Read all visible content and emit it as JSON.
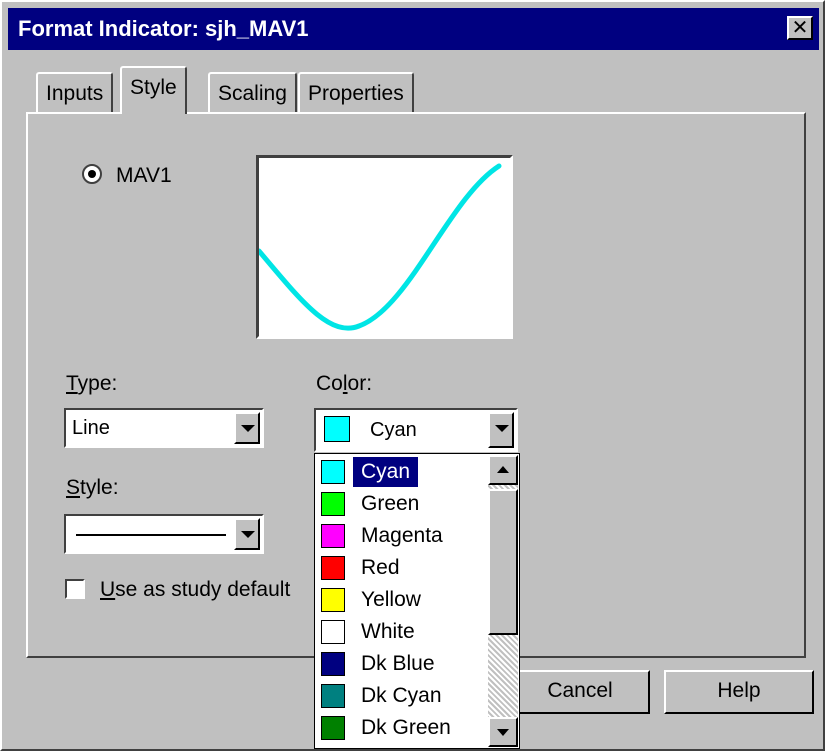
{
  "window": {
    "title": "Format Indicator: sjh_MAV1",
    "close_glyph": "✕"
  },
  "tabs": [
    {
      "label": "Inputs",
      "active": false
    },
    {
      "label": "Style",
      "active": true
    },
    {
      "label": "Scaling",
      "active": false
    },
    {
      "label": "Properties",
      "active": false
    }
  ],
  "plot_selector": {
    "label": "MAV1",
    "selected": true
  },
  "preview": {
    "line_color": "#00e5e5",
    "shape": "moving average curve"
  },
  "type_field": {
    "label": "Type:",
    "value": "Line"
  },
  "style_field": {
    "label": "Style:",
    "value": "solid line"
  },
  "color_field": {
    "label": "Color:",
    "value": "Cyan",
    "swatch": "#00ffff"
  },
  "default_checkbox": {
    "label": "Use as study default",
    "checked": false
  },
  "buttons": {
    "cancel": "Cancel",
    "help": "Help"
  },
  "color_options": [
    {
      "name": "Cyan",
      "hex": "#00ffff",
      "selected": true
    },
    {
      "name": "Green",
      "hex": "#00ff00",
      "selected": false
    },
    {
      "name": "Magenta",
      "hex": "#ff00ff",
      "selected": false
    },
    {
      "name": "Red",
      "hex": "#ff0000",
      "selected": false
    },
    {
      "name": "Yellow",
      "hex": "#ffff00",
      "selected": false
    },
    {
      "name": "White",
      "hex": "#ffffff",
      "selected": false
    },
    {
      "name": "Dk Blue",
      "hex": "#000080",
      "selected": false
    },
    {
      "name": "Dk Cyan",
      "hex": "#008080",
      "selected": false
    },
    {
      "name": "Dk Green",
      "hex": "#008000",
      "selected": false
    }
  ],
  "colors": {
    "titlebar": "#000080",
    "face": "#c0c0c0",
    "selection": "#000080"
  }
}
